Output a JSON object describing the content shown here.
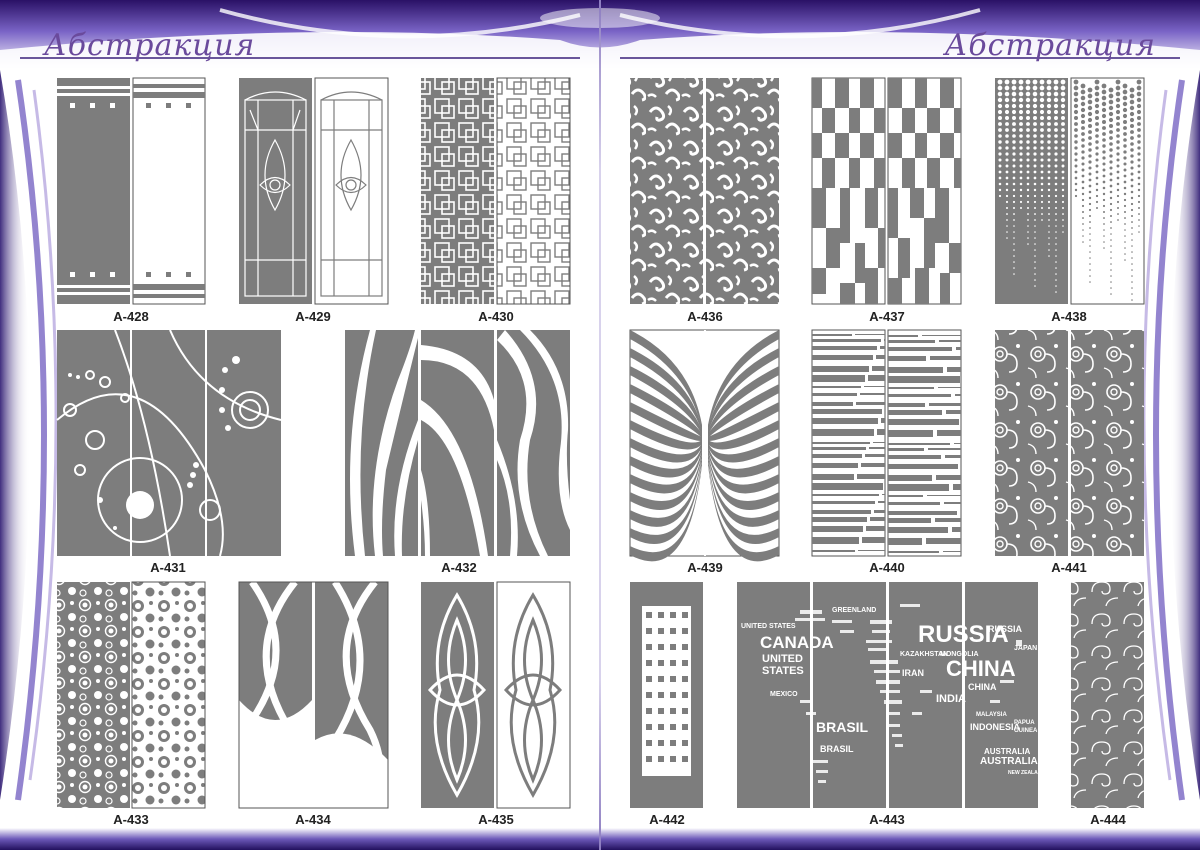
{
  "header": {
    "left_title": "Абстракция",
    "right_title": "Абстракция"
  },
  "labels": {
    "a428": "А-428",
    "a429": "А-429",
    "a430": "А-430",
    "a431": "А-431",
    "a432": "А-432",
    "a433": "А-433",
    "a434": "А-434",
    "a435": "А-435",
    "a436": "А-436",
    "a437": "А-437",
    "a438": "А-438",
    "a439": "А-439",
    "a440": "А-440",
    "a441": "А-441",
    "a442": "А-442",
    "a443": "А-443",
    "a444": "А-444"
  },
  "map_words": {
    "usa": "UNITED STATES",
    "canada": "CANADA",
    "united": "UNITED",
    "states": "STATES",
    "mexico": "MEXICO",
    "brasil": "BRASIL",
    "brasil2": "BRASIL",
    "greenland": "GREENLAND",
    "russia": "RUSSIA",
    "russia2": "RUSSIA",
    "kazakhstan": "KAZAKHSTAN",
    "mongolia": "MONGOLIA",
    "china": "CHINA",
    "china2": "CHINA",
    "iran": "IRAN",
    "india": "INDIA",
    "japan": "JAPAN",
    "malaysia": "MALAYSIA",
    "indonesia": "INDONESIA",
    "papua": "PAPUA",
    "new_guinea": "GUINEA",
    "australia": "AUSTRALIA",
    "australia2": "AUSTRALIA",
    "new_zealand": "NEW ZEALAND"
  },
  "colors": {
    "panel_gray": "#7d7d7d",
    "frame_purple": "#3a1f7a",
    "accent_lavender": "#b8a9e0"
  }
}
